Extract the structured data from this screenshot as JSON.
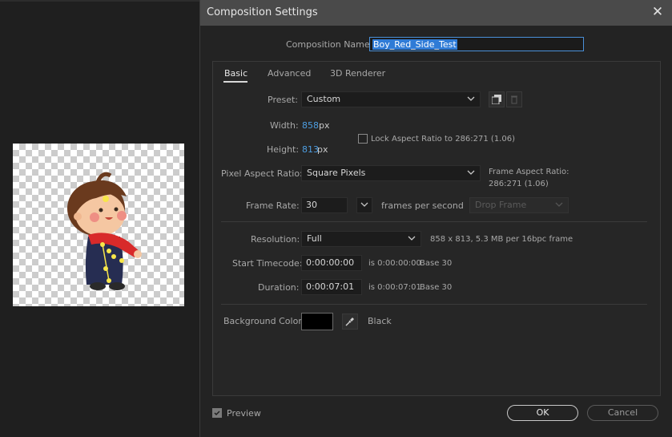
{
  "dialog": {
    "title": "Composition Settings",
    "close_glyph": "✕",
    "composition_name_label": "Composition Name:",
    "composition_name_value": "Boy_Red_Side_Test"
  },
  "tabs": [
    {
      "label": "Basic",
      "active": true
    },
    {
      "label": "Advanced",
      "active": false
    },
    {
      "label": "3D Renderer",
      "active": false
    }
  ],
  "basic": {
    "preset_label": "Preset:",
    "preset_value": "Custom",
    "width_label": "Width:",
    "width_value": "858",
    "width_unit": "px",
    "height_label": "Height:",
    "height_value": "813",
    "height_unit": "px",
    "lock_aspect_label": "Lock Aspect Ratio to 286:271 (1.06)",
    "lock_aspect_checked": false,
    "pixel_aspect_label": "Pixel Aspect Ratio:",
    "pixel_aspect_value": "Square Pixels",
    "frame_aspect_label": "Frame Aspect Ratio:",
    "frame_aspect_value": "286:271 (1.06)",
    "frame_rate_label": "Frame Rate:",
    "frame_rate_value": "30",
    "frame_rate_unit": "frames per second",
    "drop_frame_value": "Drop Frame",
    "resolution_label": "Resolution:",
    "resolution_value": "Full",
    "resolution_info": "858 x 813, 5.3 MB per 16bpc frame",
    "start_timecode_label": "Start Timecode:",
    "start_timecode_value": "0:00:00:00",
    "start_timecode_is": "is 0:00:00:00",
    "start_timecode_base": "Base 30",
    "duration_label": "Duration:",
    "duration_value": "0:00:07:01",
    "duration_is": "is 0:00:07:01",
    "duration_base": "Base 30",
    "background_color_label": "Background Color:",
    "background_color_name": "Black",
    "background_color_hex": "#000000"
  },
  "footer": {
    "preview_label": "Preview",
    "preview_checked": true,
    "ok_label": "OK",
    "cancel_label": "Cancel"
  },
  "icons": {
    "save_preset": "save-preset-icon",
    "delete_preset": "trash-icon",
    "eyedropper": "eyedropper-icon",
    "chevron": "chevron-down-icon"
  },
  "colors": {
    "accent_blue": "#4d9de0",
    "title_bar": "#4a4a4a",
    "dialog_bg": "#232323"
  }
}
